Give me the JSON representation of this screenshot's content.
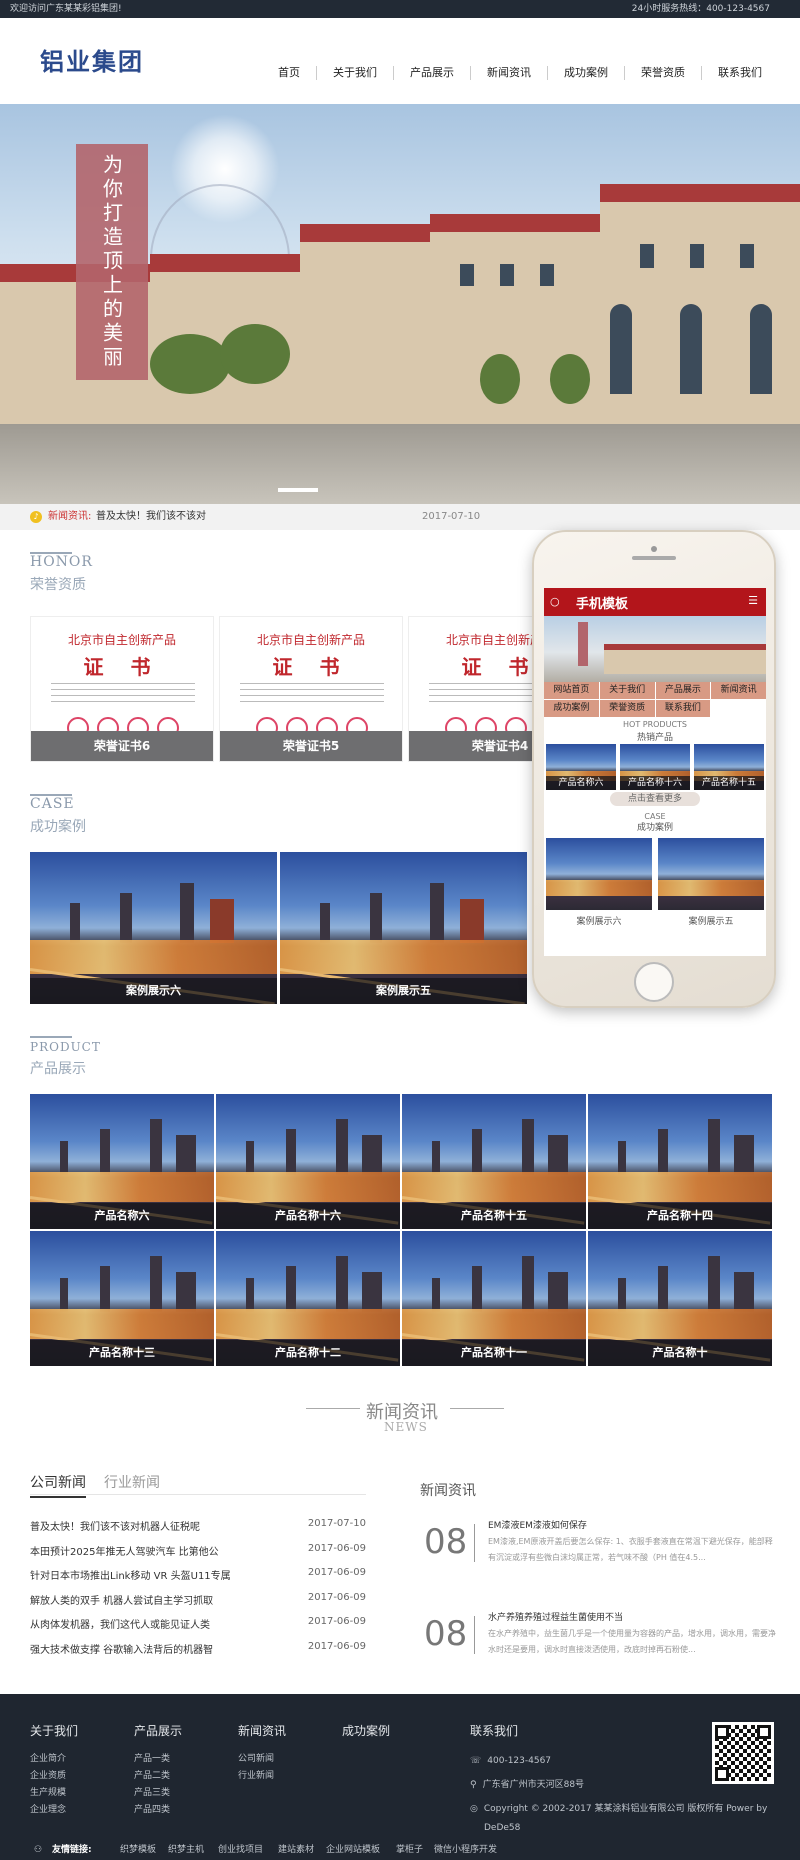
{
  "topbar": {
    "welcome": "欢迎访问广东某某彩铝集团!",
    "hotline": "24小时服务热线：400-123-4567"
  },
  "header": {
    "logo_text": "铝业集团",
    "nav": [
      "首页",
      "关于我们",
      "产品展示",
      "新闻资讯",
      "成功案例",
      "荣誉资质",
      "联系我们"
    ]
  },
  "banner": {
    "slogan": "为你打造顶上的美丽"
  },
  "ticker": {
    "label": "新闻资讯:",
    "text": "普及太快！我们该不该对",
    "date": "2017-07-10"
  },
  "honor": {
    "title_en": "HONOR",
    "title_cn": "荣誉资质",
    "cert_line1": "北京市自主创新产品",
    "cert_line2": "证 书",
    "items": [
      "荣誉证书6",
      "荣誉证书5",
      "荣誉证书4"
    ]
  },
  "case": {
    "title_en": "CASE",
    "title_cn": "成功案例",
    "items": [
      "案例展示六",
      "案例展示五"
    ]
  },
  "phone": {
    "title": "手机模板",
    "nav": [
      "网站首页",
      "关于我们",
      "产品展示",
      "新闻资讯",
      "成功案例",
      "荣誉资质",
      "联系我们"
    ],
    "hot_en": "HOT PRODUCTS",
    "hot_cn": "热销产品",
    "products": [
      "产品名称六",
      "产品名称十六",
      "产品名称十五"
    ],
    "more": "点击查看更多",
    "case_en": "CASE",
    "case_cn": "成功案例",
    "cases": [
      "案例展示六",
      "案例展示五"
    ]
  },
  "product": {
    "title_en": "PRODUCT",
    "title_cn": "产品展示",
    "items": [
      "产品名称六",
      "产品名称十六",
      "产品名称十五",
      "产品名称十四",
      "产品名称十三",
      "产品名称十二",
      "产品名称十一",
      "产品名称十"
    ]
  },
  "news": {
    "title_cn": "新闻资讯",
    "title_en": "NEWS",
    "tab_active": "公司新闻",
    "tab_other": "行业新闻",
    "list": [
      {
        "title": "普及太快！我们该不该对机器人征税呢",
        "date": "2017-07-10"
      },
      {
        "title": "本田预计2025年推无人驾驶汽车 比第他公",
        "date": "2017-06-09"
      },
      {
        "title": "针对日本市场推出Link移动 VR 头盔U11专属",
        "date": "2017-06-09"
      },
      {
        "title": "解放人类的双手 机器人尝试自主学习抓取",
        "date": "2017-06-09"
      },
      {
        "title": "从肉体发机器，我们这代人或能见证人类",
        "date": "2017-06-09"
      },
      {
        "title": "强大技术做支撑 谷歌输入法背后的机器智",
        "date": "2017-06-09"
      }
    ],
    "right_title": "新闻资讯",
    "featured": [
      {
        "day": "08",
        "title": "EM漆液EM漆液如何保存",
        "desc": "EM漆液,EM原液开盖后要怎么保存: 1、衣服手套液直在常温下避光保存，能部释有沉淀或浮有些微白沫均属正常，若气味不酸（PH 值在4.5..."
      },
      {
        "day": "08",
        "title": "水产养殖养殖过程益生菌使用不当",
        "desc": "在水产养殖中，益生菌几乎是一个使用量为容器的产品，增水用，调水用，需要净水时还是要用，调水时直接泼洒使用，改底时掉再石粉使..."
      }
    ]
  },
  "footer": {
    "cols": [
      {
        "h": "关于我们",
        "links": [
          "企业简介",
          "企业资质",
          "生产规模",
          "企业理念"
        ]
      },
      {
        "h": "产品展示",
        "links": [
          "产品一类",
          "产品二类",
          "产品三类",
          "产品四类"
        ]
      },
      {
        "h": "新闻资讯",
        "links": [
          "公司新闻",
          "行业新闻"
        ]
      },
      {
        "h": "成功案例",
        "links": []
      }
    ],
    "contact_title": "联系我们",
    "phone": "400-123-4567",
    "address": "广东省广州市天河区88号",
    "copyright": "Copyright © 2002-2017 某某涂料铝业有限公司 版权所有 Power by",
    "power": "DeDe58",
    "links_label": "友情链接:",
    "links": [
      "织梦模板",
      "织梦主机",
      "创业找项目",
      "建站素材",
      "企业网站模板",
      "掌柜子",
      "微信小程序开发"
    ]
  }
}
